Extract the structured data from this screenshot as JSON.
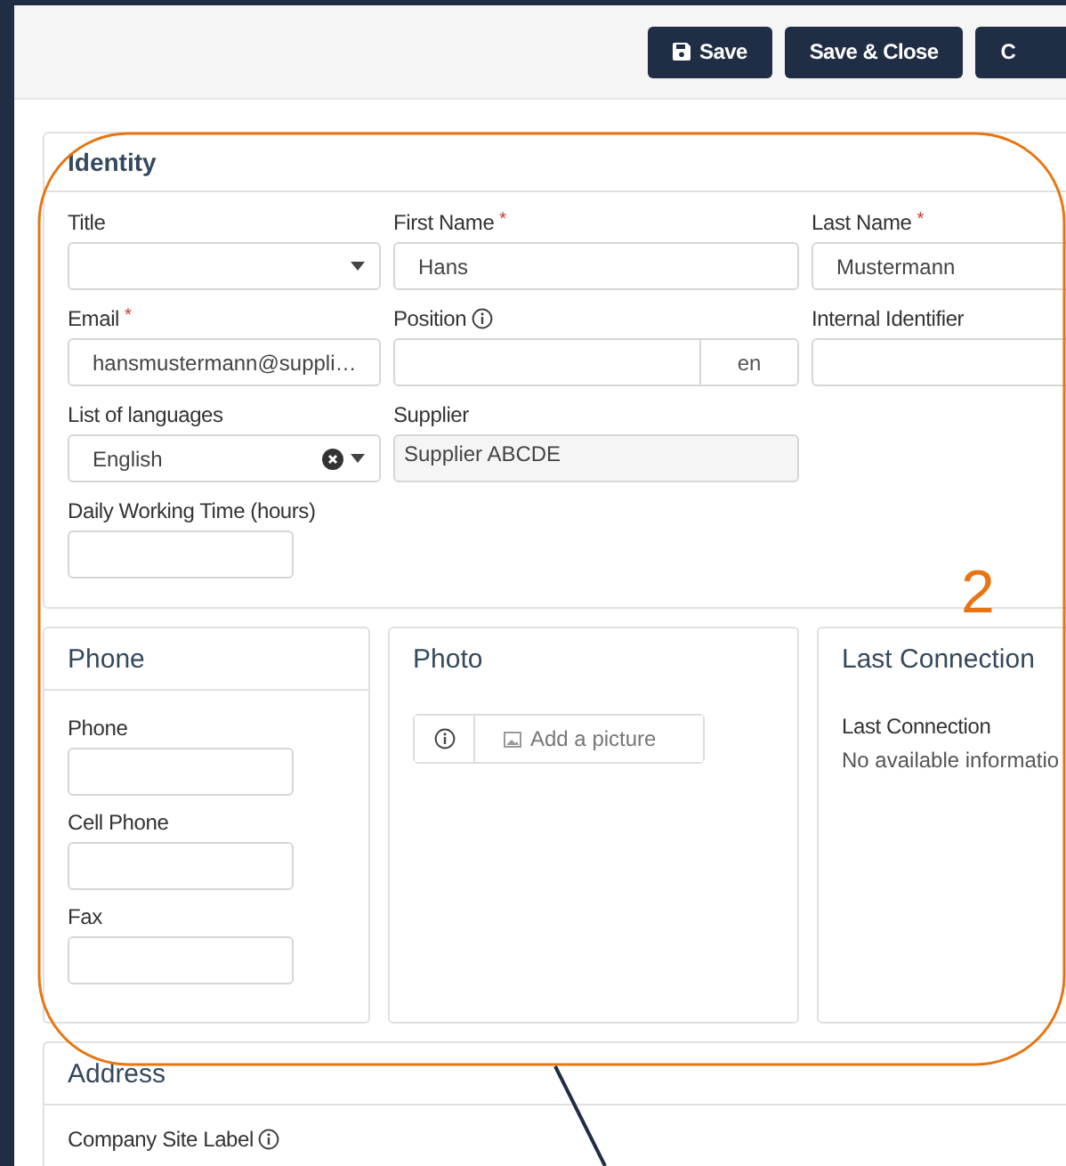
{
  "toolbar": {
    "buttons": [
      {
        "label": "Save",
        "kind": "with_icon"
      },
      {
        "label": "Save & Close",
        "kind": "plain"
      },
      {
        "label": "C",
        "kind": "plain"
      }
    ]
  },
  "identity": {
    "title": "Identity",
    "rows": [
      [
        {
          "label": "Title",
          "kind": "select"
        },
        {
          "label": "First Name",
          "kind": "text",
          "required_mark": "*",
          "value": "Hans"
        },
        {
          "label": "Last Name",
          "kind": "text",
          "required_mark": "*",
          "value": "Mustermann"
        }
      ],
      [
        {
          "label": "Email",
          "kind": "text",
          "required_mark": "*",
          "value": "hansmustermann@suppli…"
        },
        {
          "label": "Position",
          "kind": "localized",
          "info": true,
          "addon": "en"
        },
        {
          "label": "Internal Identifier",
          "kind": "text"
        }
      ],
      [
        {
          "label": "List of languages",
          "kind": "select",
          "value": "English",
          "clearable": true
        },
        {
          "label": "Supplier",
          "kind": "readonly",
          "value": "Supplier ABCDE"
        }
      ],
      [
        {
          "label": "Daily Working Time (hours)",
          "kind": "short"
        }
      ]
    ]
  },
  "phone": {
    "title": "Phone",
    "fields": [
      {
        "label": "Phone"
      },
      {
        "label": "Cell Phone"
      },
      {
        "label": "Fax"
      }
    ]
  },
  "photo": {
    "title": "Photo",
    "button": "Add a picture"
  },
  "last_connection": {
    "title": "Last Connection",
    "label": "Last Connection",
    "text": "No available informatio"
  },
  "address": {
    "title": "Address",
    "fields": [
      {
        "label": "Company Site Label",
        "info": true
      }
    ]
  },
  "annotation": {
    "label": "2"
  }
}
